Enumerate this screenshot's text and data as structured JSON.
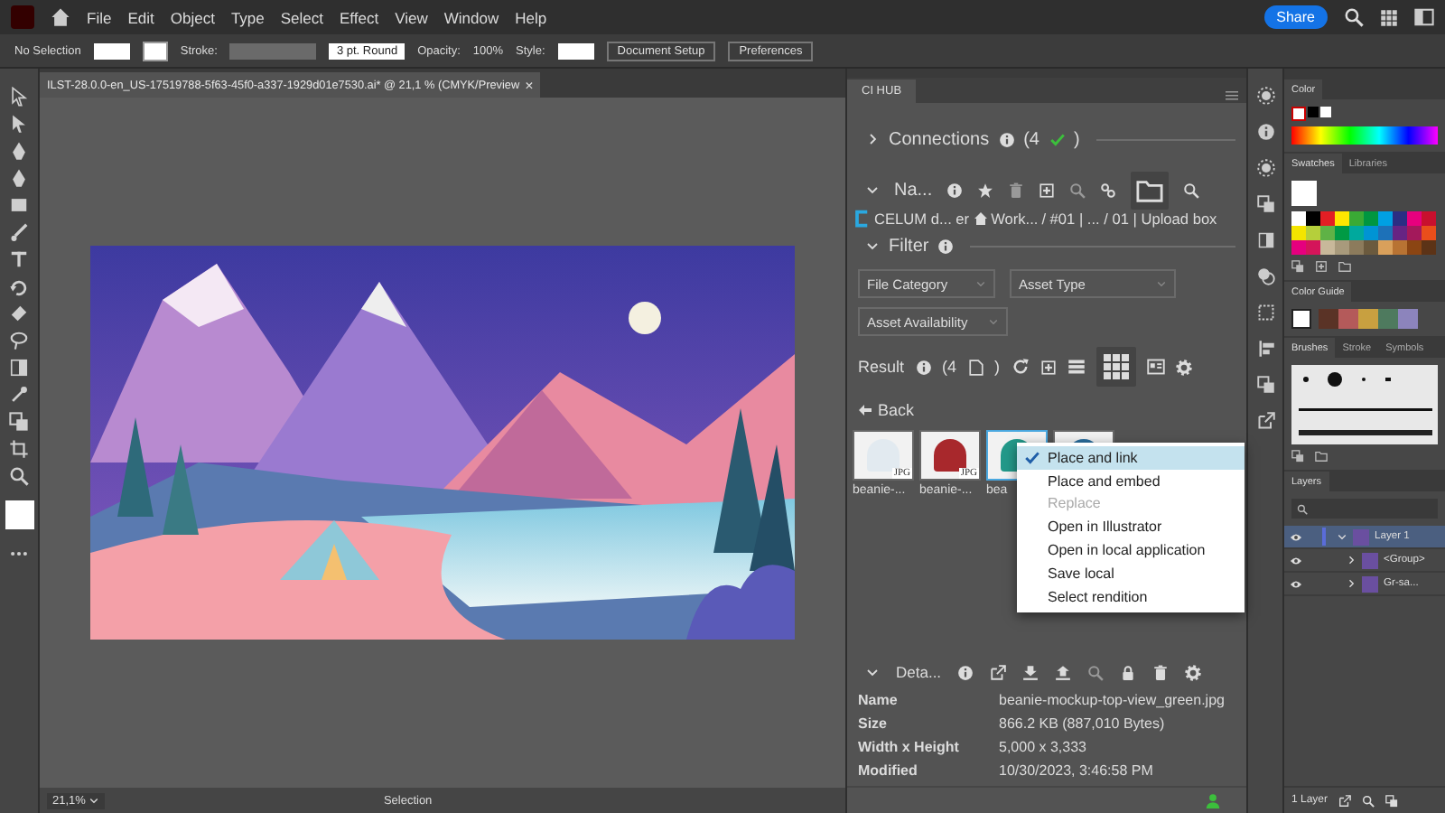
{
  "menubar": {
    "menus": [
      "File",
      "Edit",
      "Object",
      "Type",
      "Select",
      "Effect",
      "View",
      "Window",
      "Help"
    ],
    "share": "Share"
  },
  "control_bar": {
    "selection": "No Selection",
    "stroke_label": "Stroke:",
    "brush": "3 pt. Round",
    "opacity_label": "Opacity:",
    "opacity": "100%",
    "style_label": "Style:",
    "buttons": [
      "Document Setup",
      "Preferences"
    ]
  },
  "document": {
    "title": "ILST-28.0.0-en_US-17519788-5f63-45f0-a337-1929d01e7530.ai* @ 21,1 % (CMYK/Preview",
    "close": "×",
    "zoom": "21,1%",
    "tool": "Selection"
  },
  "hub": {
    "tab": "CI HUB",
    "connections": {
      "label": "Connections",
      "count": "(4",
      "count_end": ")"
    },
    "navigation": {
      "label": "Na..."
    },
    "breadcrumb": {
      "source": "CELUM d... er",
      "folder": "Work...",
      "path": "/ #01 | ... / 01 | Upload box"
    },
    "filter": {
      "label": "Filter",
      "dropdowns": [
        "File Category",
        "Asset Type",
        "Asset Availability"
      ]
    },
    "result": {
      "label": "Result",
      "count": "(4",
      "count_end": ")"
    },
    "back": "Back",
    "assets": [
      {
        "label": "beanie-...",
        "badge": "JPG",
        "color": "#e2eaf0",
        "selected": false
      },
      {
        "label": "beanie-...",
        "badge": "JPG",
        "color": "#a8282c",
        "selected": false
      },
      {
        "label": "bea",
        "color": "#23998a",
        "selected": true
      },
      {
        "color": "#2a6e9e",
        "selected": false
      }
    ],
    "context_menu": {
      "items": [
        {
          "label": "Place and link",
          "checked": true,
          "selected": true,
          "disabled": false
        },
        {
          "label": "Place and embed",
          "checked": false,
          "selected": false,
          "disabled": false
        },
        {
          "label": "Replace",
          "checked": false,
          "selected": false,
          "disabled": true
        },
        {
          "label": "Open in Illustrator",
          "checked": false,
          "selected": false,
          "disabled": false
        },
        {
          "label": "Open in local application",
          "checked": false,
          "selected": false,
          "disabled": false
        },
        {
          "label": "Save local",
          "checked": false,
          "selected": false,
          "disabled": false
        },
        {
          "label": "Select rendition",
          "checked": false,
          "selected": false,
          "disabled": false
        }
      ]
    },
    "details": {
      "label": "Deta...",
      "rows": [
        {
          "key": "Name",
          "value": "beanie-mockup-top-view_green.jpg"
        },
        {
          "key": "Size",
          "value": "866.2 KB (887,010 Bytes)"
        },
        {
          "key": "Width x Height",
          "value": "5,000 x 3,333"
        },
        {
          "key": "Modified",
          "value": "10/30/2023, 3:46:58 PM"
        }
      ]
    }
  },
  "dock": {
    "color": {
      "tab": "Color"
    },
    "swatches": {
      "tabs": [
        {
          "label": "Swatches",
          "selected": true
        },
        {
          "label": "Libraries",
          "selected": false
        }
      ],
      "colors": [
        {
          "color": "#ffffff"
        },
        {
          "color": "#000000"
        },
        {
          "color": "#e31e24"
        },
        {
          "color": "#ffe600"
        },
        {
          "color": "#3aaa35"
        },
        {
          "color": "#009640"
        },
        {
          "color": "#00a0e3"
        },
        {
          "color": "#2b2e83"
        },
        {
          "color": "#e6007e"
        },
        {
          "color": "#c8102e"
        },
        {
          "color": "#f4e500"
        },
        {
          "color": "#b5cf3b"
        },
        {
          "color": "#5fb246"
        },
        {
          "color": "#009a44"
        },
        {
          "color": "#00a99d"
        },
        {
          "color": "#0094d4"
        },
        {
          "color": "#1d71b8"
        },
        {
          "color": "#662483"
        },
        {
          "color": "#a3195b"
        },
        {
          "color": "#e94e1b"
        },
        {
          "color": "#e5007e"
        },
        {
          "color": "#d4145a"
        },
        {
          "color": "#c8b89a"
        },
        {
          "color": "#a89a7c"
        },
        {
          "color": "#8c7b5c"
        },
        {
          "color": "#6b5a3e"
        },
        {
          "color": "#d9a05b"
        },
        {
          "color": "#b87333"
        },
        {
          "color": "#8b4513"
        },
        {
          "color": "#5c3317"
        }
      ]
    },
    "color_guide": {
      "tab": "Color Guide",
      "colors": [
        {
          "color": "#5a3326"
        },
        {
          "color": "#b45a5a"
        },
        {
          "color": "#c8a040"
        },
        {
          "color": "#4e7a5e"
        },
        {
          "color": "#8c84bc"
        }
      ]
    },
    "brushes": {
      "tabs": [
        {
          "label": "Brushes",
          "selected": true
        },
        {
          "label": "Stroke",
          "selected": false
        },
        {
          "label": "Symbols",
          "selected": false
        }
      ]
    },
    "layers": {
      "tab": "Layers",
      "items": [
        {
          "name": "Layer 1",
          "selected": true,
          "expanded": true,
          "children": [
            {
              "name": "<Group>",
              "selected": false,
              "expanded": false
            },
            {
              "name": "Gr-sa...",
              "selected": false,
              "expanded": false
            }
          ]
        }
      ],
      "footer": "1 Layer"
    }
  }
}
